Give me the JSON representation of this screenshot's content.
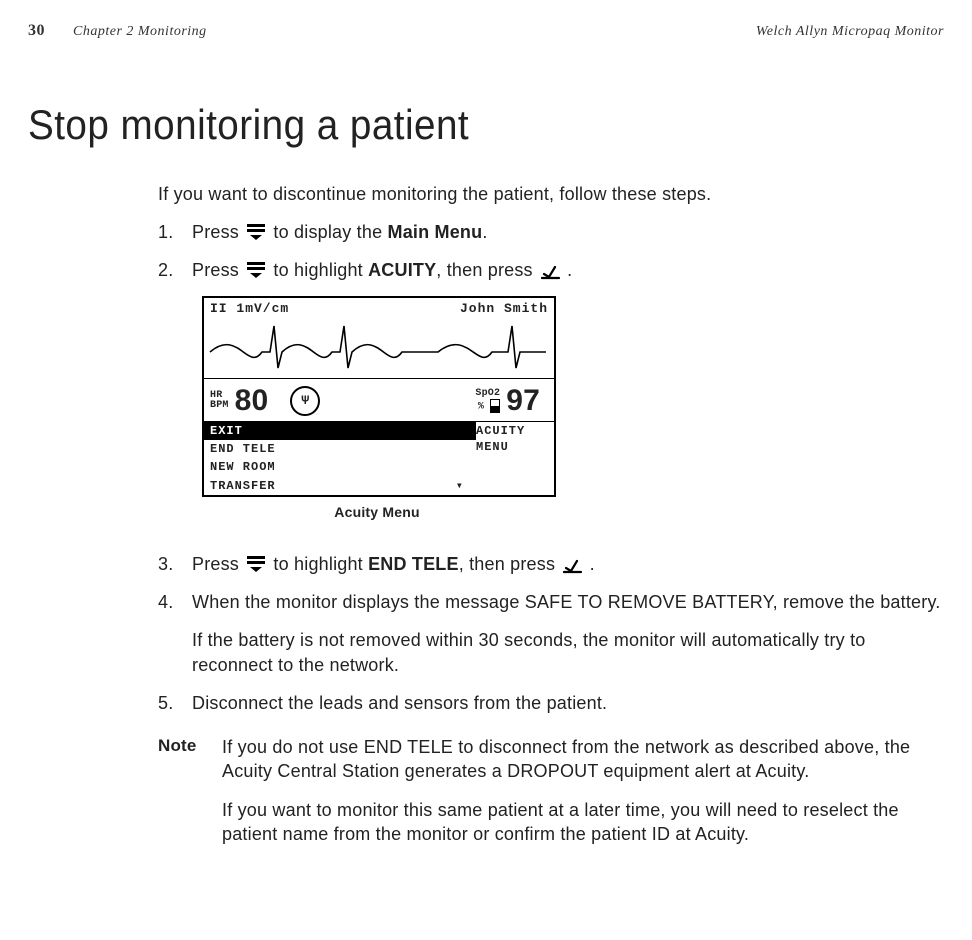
{
  "runhead": {
    "page_no": "30",
    "chapter": "Chapter 2   Monitoring",
    "product": "Welch Allyn Micropaq Monitor"
  },
  "title": "Stop monitoring a patient",
  "intro": "If you want to discontinue monitoring the patient, follow these steps.",
  "steps": {
    "s1_a": "Press ",
    "s1_b": " to display the ",
    "s1_bold": "Main Menu",
    "s1_c": ".",
    "s2_a": "Press ",
    "s2_b": " to highlight ",
    "s2_bold": "ACUITY",
    "s2_c": ", then press ",
    "s2_d": ".",
    "s3_a": "Press ",
    "s3_b": " to highlight ",
    "s3_bold": "END TELE",
    "s3_c": ", then press ",
    "s3_d": ".",
    "s4": "When the monitor displays the message SAFE TO REMOVE BATTERY, remove the battery.",
    "s4_sub": "If the battery is not removed within 30 seconds, the monitor will automatically try to reconnect to the network.",
    "s5": "Disconnect the leads and sensors from the patient."
  },
  "nums": {
    "n1": "1.",
    "n2": "2.",
    "n3": "3.",
    "n4": "4.",
    "n5": "5."
  },
  "screenshot": {
    "lead": "II 1mV/cm",
    "name": "John Smith",
    "hr_lbl1": "HR",
    "hr_lbl2": "BPM",
    "hr_val": "80",
    "spo2_lbl": "SpO2",
    "spo2_pct": "%",
    "spo2_val": "97",
    "menu_items": {
      "exit": "EXIT",
      "end": "END TELE",
      "room": "NEW ROOM",
      "transfer": "TRANSFER"
    },
    "menu_right1": "ACUITY",
    "menu_right2": "MENU",
    "caption": "Acuity Menu",
    "down_arrow": "▾"
  },
  "note": {
    "label": "Note",
    "p1": "If you do not use END TELE to disconnect from the network as described above, the Acuity Central Station generates a DROPOUT equipment alert at Acuity.",
    "p2": "If you want to monitor this same patient at a later time, you will need to reselect the patient name from the monitor or confirm the patient ID at Acuity."
  }
}
